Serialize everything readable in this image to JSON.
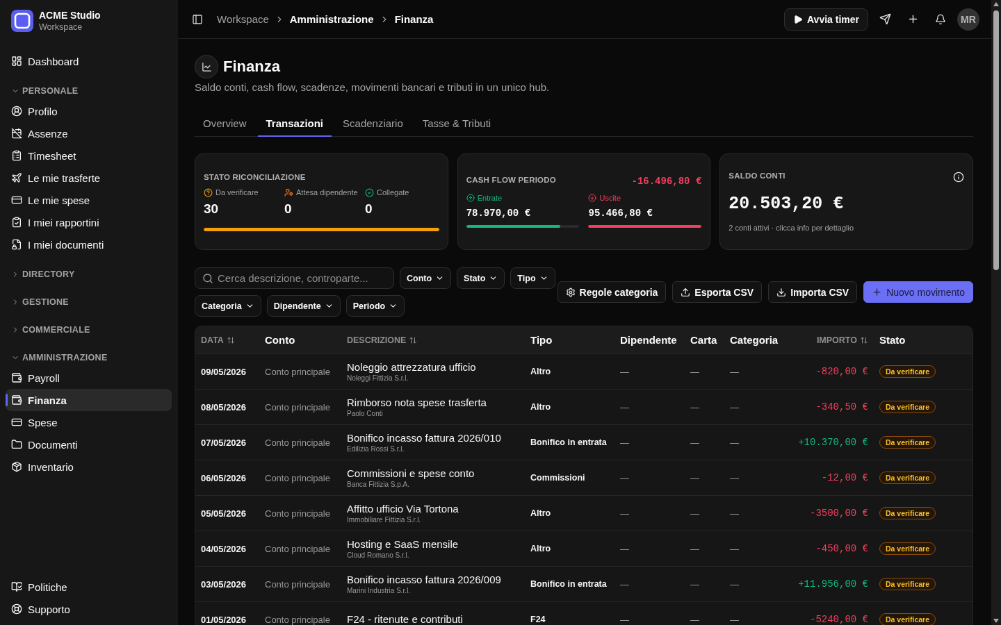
{
  "sidebar": {
    "brand": {
      "name": "ACME Studio",
      "subtitle": "Workspace"
    },
    "top_items": [
      {
        "label": "Dashboard",
        "selected": false
      }
    ],
    "sections": [
      {
        "title": "PERSONALE",
        "expanded": true,
        "items": [
          {
            "label": "Profilo",
            "selected": false
          },
          {
            "label": "Assenze",
            "selected": false
          },
          {
            "label": "Timesheet",
            "selected": false
          },
          {
            "label": "Le mie trasferte",
            "selected": false
          },
          {
            "label": "Le mie spese",
            "selected": false
          },
          {
            "label": "I miei rapportini",
            "selected": false
          },
          {
            "label": "I miei documenti",
            "selected": false
          }
        ]
      },
      {
        "title": "DIRECTORY",
        "expanded": false
      },
      {
        "title": "GESTIONE",
        "expanded": false
      },
      {
        "title": "COMMERCIALE",
        "expanded": false
      },
      {
        "title": "AMMINISTRAZIONE",
        "expanded": true,
        "items": [
          {
            "label": "Payroll",
            "selected": false
          },
          {
            "label": "Finanza",
            "selected": true
          },
          {
            "label": "Spese",
            "selected": false
          },
          {
            "label": "Documenti",
            "selected": false
          },
          {
            "label": "Inventario",
            "selected": false
          }
        ]
      }
    ],
    "bottom_items": [
      {
        "label": "Politiche",
        "selected": false
      },
      {
        "label": "Supporto",
        "selected": false
      }
    ]
  },
  "header": {
    "breadcrumb": [
      {
        "label": "Workspace",
        "dimmed": true
      },
      {
        "label": "Amministrazione",
        "dimmed": false
      },
      {
        "label": "Finanza",
        "dimmed": false
      }
    ],
    "timer_button": "Avvia timer",
    "avatar": "MR"
  },
  "page": {
    "title": "Finanza",
    "description": "Saldo conti, cash flow, scadenze, movimenti bancari e tributi in un unico hub.",
    "tabs": [
      {
        "label": "Overview",
        "selected": false
      },
      {
        "label": "Transazioni",
        "selected": true
      },
      {
        "label": "Scadenziario",
        "selected": false
      },
      {
        "label": "Tasse & Tributi",
        "selected": false
      }
    ]
  },
  "reconciliation": {
    "title": "STATO RICONCILIAZIONE",
    "stats": [
      {
        "kind": "pending",
        "label": "Da verificare",
        "value": "30"
      },
      {
        "kind": "waiting",
        "label": "Attesa dipendente",
        "value": "0"
      },
      {
        "kind": "linked",
        "label": "Collegate",
        "value": "0"
      }
    ],
    "level": 1
  },
  "cash_flow": {
    "title": "CASH FLOW PERIODO",
    "total": "-16.496,80 €",
    "negative": true,
    "entries": [
      {
        "kind": "in",
        "label": "Entrate",
        "amount": "78.970,00 €",
        "level": 0.83
      },
      {
        "kind": "out",
        "label": "Uscite",
        "amount": "95.466,80 €",
        "level": 1
      }
    ]
  },
  "balance": {
    "title": "SALDO CONTI",
    "amount": "20.503,20 €",
    "note": "2 conti attivi · clicca info per dettaglio"
  },
  "filters": {
    "search": {
      "placeholder": "Cerca descrizione, controparte..."
    },
    "dropdowns": [
      "Conto",
      "Stato",
      "Tipo",
      "Categoria",
      "Dipendente",
      "Periodo"
    ],
    "actions": [
      {
        "label": "Regole categoria",
        "kind": "secondary"
      },
      {
        "label": "Esporta CSV",
        "kind": "secondary"
      },
      {
        "label": "Importa CSV",
        "kind": "secondary"
      },
      {
        "label": "Nuovo movimento",
        "kind": "primary"
      }
    ]
  },
  "table": {
    "columns": [
      {
        "label": "DATA",
        "sortable": true
      },
      {
        "label": "Conto",
        "sortable": false
      },
      {
        "label": "DESCRIZIONE",
        "sortable": true
      },
      {
        "label": "Tipo",
        "sortable": false
      },
      {
        "label": "Dipendente",
        "sortable": false
      },
      {
        "label": "Carta",
        "sortable": false
      },
      {
        "label": "Categoria",
        "sortable": false
      },
      {
        "label": "IMPORTO",
        "sortable": true
      },
      {
        "label": "Stato",
        "sortable": false
      }
    ],
    "rows": [
      {
        "date": "09/05/2026",
        "account": "Conto principale",
        "title": "Noleggio attrezzatura ufficio",
        "counterparty": "Noleggi Fittizia S.r.l.",
        "type": "Altro",
        "employee": "—",
        "card": "—",
        "category": "—",
        "amount": "-820,00 €",
        "kind": "expense",
        "status": "Da verificare"
      },
      {
        "date": "08/05/2026",
        "account": "Conto principale",
        "title": "Rimborso nota spese trasferta",
        "counterparty": "Paolo Conti",
        "type": "Altro",
        "employee": "—",
        "card": "—",
        "category": "—",
        "amount": "-340,50 €",
        "kind": "expense",
        "status": "Da verificare"
      },
      {
        "date": "07/05/2026",
        "account": "Conto principale",
        "title": "Bonifico incasso fattura 2026/010",
        "counterparty": "Edilizia Rossi S.r.l.",
        "type": "Bonifico in entrata",
        "employee": "—",
        "card": "—",
        "category": "—",
        "amount": "+10.370,00 €",
        "kind": "income",
        "status": "Da verificare"
      },
      {
        "date": "06/05/2026",
        "account": "Conto principale",
        "title": "Commissioni e spese conto",
        "counterparty": "Banca Fittizia S.p.A.",
        "type": "Commissioni",
        "employee": "—",
        "card": "—",
        "category": "—",
        "amount": "-12,00 €",
        "kind": "expense",
        "status": "Da verificare"
      },
      {
        "date": "05/05/2026",
        "account": "Conto principale",
        "title": "Affitto ufficio Via Tortona",
        "counterparty": "Immobiliare Fittizia S.r.l.",
        "type": "Altro",
        "employee": "—",
        "card": "—",
        "category": "—",
        "amount": "-3500,00 €",
        "kind": "expense",
        "status": "Da verificare"
      },
      {
        "date": "04/05/2026",
        "account": "Conto principale",
        "title": "Hosting e SaaS mensile",
        "counterparty": "Cloud Romano S.r.l.",
        "type": "Altro",
        "employee": "—",
        "card": "—",
        "category": "—",
        "amount": "-450,00 €",
        "kind": "expense",
        "status": "Da verificare"
      },
      {
        "date": "03/05/2026",
        "account": "Conto principale",
        "title": "Bonifico incasso fattura 2026/009",
        "counterparty": "Marini Industria S.r.l.",
        "type": "Bonifico in entrata",
        "employee": "—",
        "card": "—",
        "category": "—",
        "amount": "+11.956,00 €",
        "kind": "income",
        "status": "Da verificare"
      },
      {
        "date": "01/05/2026",
        "account": "Conto principale",
        "title": "F24 - ritenute e contributi",
        "type": "F24",
        "employee": "—",
        "card": "—",
        "category": "—",
        "amount": "-5240,00 €",
        "kind": "expense",
        "status": "Da verificare"
      }
    ]
  }
}
